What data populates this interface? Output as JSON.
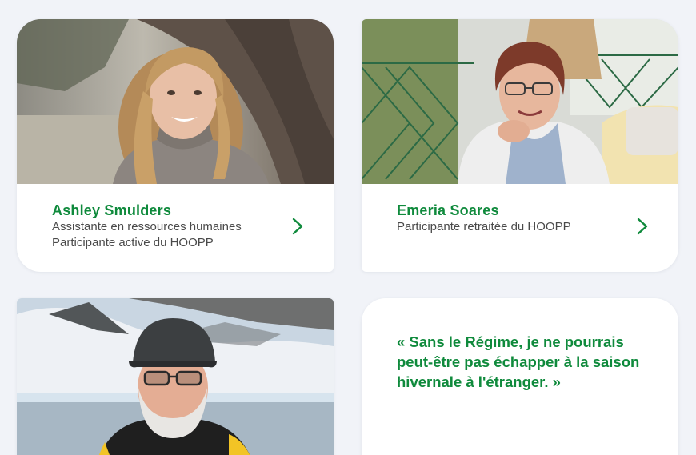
{
  "testimonials": [
    {
      "name": "Ashley Smulders",
      "role_line1": "Assistante en ressources humaines",
      "role_line2": "Participante active du HOOPP",
      "photo_icon": "portrait-photo"
    },
    {
      "name": "Emeria Soares",
      "role_line1": "Participante retraitée du HOOPP",
      "photo_icon": "portrait-photo"
    },
    {
      "photo_icon": "portrait-photo"
    }
  ],
  "quote": {
    "text": "« Sans le Régime, je ne pourrais peut-être pas échapper à la saison hivernale à l'étranger. »"
  },
  "colors": {
    "accent_green": "#0f8a3c",
    "page_bg": "#f1f3f8",
    "card_bg": "#ffffff"
  },
  "icons": {
    "chevron": "chevron-right-icon"
  }
}
